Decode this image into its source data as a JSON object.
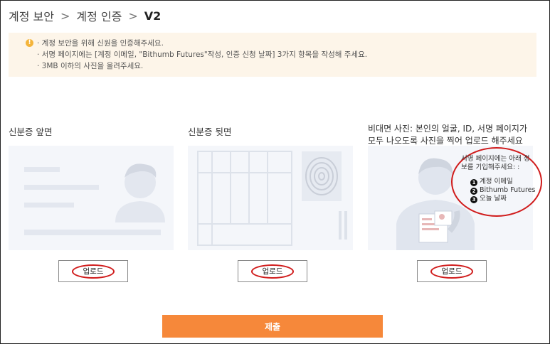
{
  "breadcrumb": {
    "items": [
      "계정 보안",
      "계정 인증"
    ],
    "current": "V2",
    "separator": ">"
  },
  "notice": {
    "icon": "warning-icon",
    "lines": [
      "· 계정 보안을 위해 신원을 인증해주세요.",
      "· 서명 페이지에는 [계정 이메일, \"Bithumb Futures\"작성, 인증 신청 날짜] 3가지 항목을 작성해 주세요.",
      "· 3MB 이하의 사진을 올려주세요."
    ]
  },
  "columns": [
    {
      "label": "신분증 앞면",
      "upload_label": "업로드"
    },
    {
      "label": "신분증 뒷면",
      "upload_label": "업로드"
    },
    {
      "label": "비대면 사진: 본인의 얼굴, ID, 서명 페이지가 모두 나오도록 사진을 찍어 업로드 해주세요",
      "label_line1": "비대면 사진: 본인의 얼굴, ID, 서명 페이지가",
      "label_line2": "모두 나오도록 사진을 찍어 업로드 해주세요",
      "upload_label": "업로드"
    }
  ],
  "annotation": {
    "line1": "서명 페이지에는 아래 정",
    "line2": "보를 기입해주세요: :",
    "items": [
      {
        "num": "1",
        "text": "계정 이메일"
      },
      {
        "num": "2",
        "text": "Bithumb Futures"
      },
      {
        "num": "3",
        "text": "오늘 날짜"
      }
    ]
  },
  "submit_label": "제출",
  "colors": {
    "accent": "#f6883a",
    "notice_bg": "#fdf5e9",
    "warning": "#f4b43a",
    "annotation": "#d01b1b"
  }
}
